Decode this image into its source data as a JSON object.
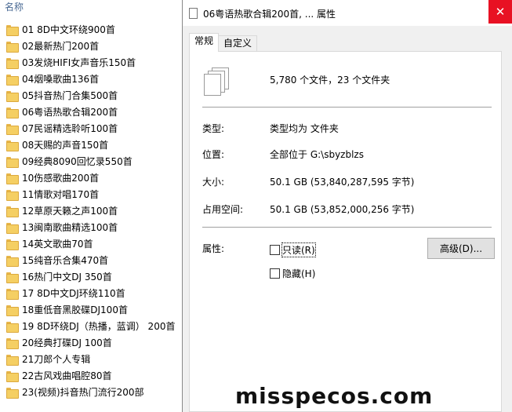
{
  "explorer": {
    "column_header": "名称",
    "folders": [
      "01 8D中文环绕900首",
      "02最新热门200首",
      "03发烧HIFI女声音乐150首",
      "04烟嗓歌曲136首",
      "05抖音热门合集500首",
      "06粤语热歌合辑200首",
      "07民谣精选聆听100首",
      "08天赐的声音150首",
      "09经典8090回忆录550首",
      "10伤感歌曲200首",
      "11情歌对唱170首",
      "12草原天籁之声100首",
      "13闽南歌曲精选100首",
      "14英文歌曲70首",
      "15纯音乐合集470首",
      "16热门中文DJ 350首",
      "17 8D中文DJ环绕110首",
      "18重低音黑胶碟DJ100首",
      "19 8D环绕DJ（热播，蓝调） 200首",
      "20经典打碟DJ 100首",
      "21刀郎个人专辑",
      "22古风戏曲唱腔80首",
      "23(视频)抖音热门流行200部"
    ]
  },
  "dialog": {
    "title": "06粤语热歌合辑200首, ... 属性",
    "close_glyph": "✕",
    "tabs": [
      "常规",
      "自定义"
    ],
    "summary": "5,780 个文件，23 个文件夹",
    "type_label": "类型:",
    "type_value": "类型均为 文件夹",
    "location_label": "位置:",
    "location_value": "全部位于 G:\\sbyzblzs",
    "size_label": "大小:",
    "size_value": "50.1 GB (53,840,287,595 字节)",
    "disk_label": "占用空间:",
    "disk_value": "50.1 GB (53,852,000,256 字节)",
    "attributes_label": "属性:",
    "readonly_label": "只读(R)",
    "readonly_checked": false,
    "hidden_label": "隐藏(H)",
    "hidden_checked": false,
    "advanced_button": "高级(D)..."
  },
  "watermark": "misspecos.com"
}
